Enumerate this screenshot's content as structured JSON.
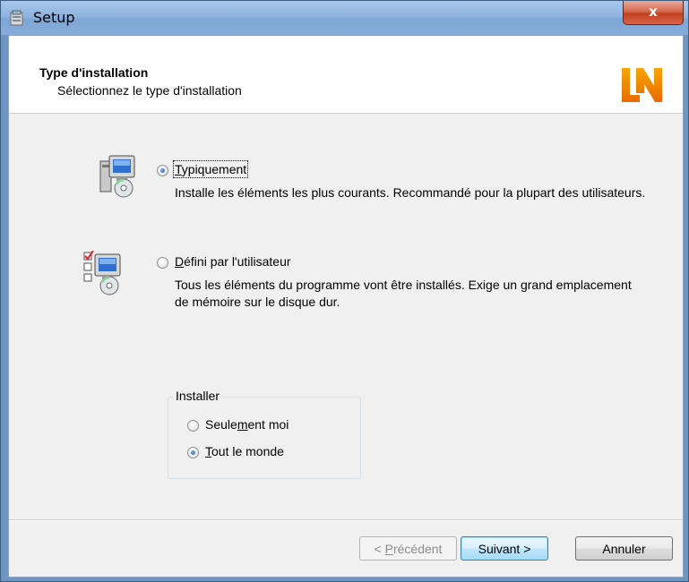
{
  "window": {
    "title": "Setup",
    "close_glyph": "x"
  },
  "header": {
    "title": "Type d'installation",
    "subtitle": "Sélectionnez le type d'installation",
    "logo": "LN"
  },
  "options": [
    {
      "label_mnemonic": "T",
      "label_rest": "ypiquement",
      "selected": true,
      "description": "Installe les éléments les plus courants. Recommandé pour la plupart des utilisateurs.",
      "icon": "computer-cd-icon"
    },
    {
      "label_mnemonic": "D",
      "label_rest": "éfini par l'utilisateur",
      "selected": false,
      "description": "Tous les éléments du programme vont être installés. Exige un grand emplacement de mémoire sur le disque dur.",
      "icon": "computer-checklist-icon"
    }
  ],
  "install_group": {
    "title": "Installer",
    "options": [
      {
        "before": "Seule",
        "mnemonic": "m",
        "after": "ent moi",
        "selected": false
      },
      {
        "before": "",
        "mnemonic": "T",
        "after": "out le monde",
        "selected": true
      }
    ]
  },
  "buttons": {
    "back_prefix": "< ",
    "back_mnemonic": "P",
    "back_rest": "récédent",
    "next": "Suivant >",
    "cancel": "Annuler"
  }
}
